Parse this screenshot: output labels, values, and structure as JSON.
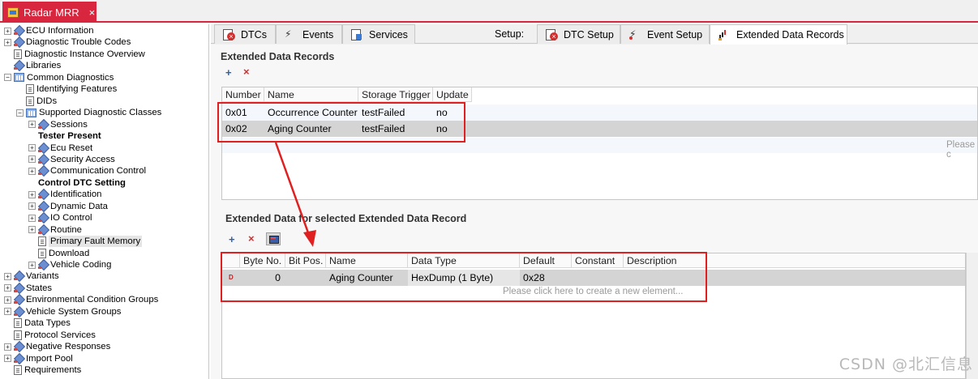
{
  "document_tab": {
    "title": "Radar MRR",
    "close": "×"
  },
  "tree": [
    {
      "label": "ECU Information",
      "indent": 0,
      "exp": "+",
      "icon": "diamond"
    },
    {
      "label": "Diagnostic Trouble Codes",
      "indent": 0,
      "exp": "+",
      "icon": "diamond"
    },
    {
      "label": "Diagnostic Instance Overview",
      "indent": 0,
      "exp": "",
      "icon": "doc"
    },
    {
      "label": "Libraries",
      "indent": 0,
      "exp": "",
      "icon": "diamond"
    },
    {
      "label": "Common Diagnostics",
      "indent": 0,
      "exp": "-",
      "icon": "folder"
    },
    {
      "label": "Identifying Features",
      "indent": 1,
      "exp": "",
      "icon": "doc"
    },
    {
      "label": "DIDs",
      "indent": 1,
      "exp": "",
      "icon": "doc"
    },
    {
      "label": "Supported Diagnostic Classes",
      "indent": 1,
      "exp": "-",
      "icon": "folder"
    },
    {
      "label": "Sessions",
      "indent": 2,
      "exp": "+",
      "icon": "diamond"
    },
    {
      "label": "Tester Present",
      "indent": 2,
      "exp": "",
      "icon": "none",
      "bold": true
    },
    {
      "label": "Ecu Reset",
      "indent": 2,
      "exp": "+",
      "icon": "diamond"
    },
    {
      "label": "Security Access",
      "indent": 2,
      "exp": "+",
      "icon": "diamond"
    },
    {
      "label": "Communication Control",
      "indent": 2,
      "exp": "+",
      "icon": "diamond"
    },
    {
      "label": "Control DTC Setting",
      "indent": 2,
      "exp": "",
      "icon": "none",
      "bold": true
    },
    {
      "label": "Identification",
      "indent": 2,
      "exp": "+",
      "icon": "diamond"
    },
    {
      "label": "Dynamic Data",
      "indent": 2,
      "exp": "+",
      "icon": "diamond"
    },
    {
      "label": "IO Control",
      "indent": 2,
      "exp": "+",
      "icon": "diamond"
    },
    {
      "label": "Routine",
      "indent": 2,
      "exp": "+",
      "icon": "diamond"
    },
    {
      "label": "Primary Fault Memory",
      "indent": 2,
      "exp": "",
      "icon": "doc",
      "selected": true
    },
    {
      "label": "Download",
      "indent": 2,
      "exp": "",
      "icon": "doc"
    },
    {
      "label": "Vehicle Coding",
      "indent": 2,
      "exp": "+",
      "icon": "diamond"
    },
    {
      "label": "Variants",
      "indent": 0,
      "exp": "+",
      "icon": "diamond"
    },
    {
      "label": "States",
      "indent": 0,
      "exp": "+",
      "icon": "diamond"
    },
    {
      "label": "Environmental Condition Groups",
      "indent": 0,
      "exp": "+",
      "icon": "diamond"
    },
    {
      "label": "Vehicle System Groups",
      "indent": 0,
      "exp": "+",
      "icon": "diamond"
    },
    {
      "label": "Data Types",
      "indent": 0,
      "exp": "",
      "icon": "doc"
    },
    {
      "label": "Protocol Services",
      "indent": 0,
      "exp": "",
      "icon": "doc"
    },
    {
      "label": "Negative Responses",
      "indent": 0,
      "exp": "+",
      "icon": "diamond"
    },
    {
      "label": "Import Pool",
      "indent": 0,
      "exp": "+",
      "icon": "diamond"
    },
    {
      "label": "Requirements",
      "indent": 0,
      "exp": "",
      "icon": "doc"
    }
  ],
  "view_tabs": {
    "dtcs": "DTCs",
    "events": "Events",
    "services": "Services",
    "setup_label": "Setup:",
    "dtc_setup": "DTC Setup",
    "event_setup": "Event Setup",
    "extended_data_records": "Extended Data Records"
  },
  "records_section": {
    "title": "Extended Data Records",
    "add": "+",
    "remove": "×",
    "columns": [
      "Number",
      "Name",
      "Storage Trigger",
      "Update"
    ],
    "rows": [
      {
        "number": "0x01",
        "name": "Occurrence Counter",
        "trigger": "testFailed",
        "update": "no"
      },
      {
        "number": "0x02",
        "name": "Aging Counter",
        "trigger": "testFailed",
        "update": "no"
      }
    ],
    "placeholder": "Please c"
  },
  "data_section": {
    "title": "Extended Data for selected Extended Data Record",
    "add": "+",
    "remove": "×",
    "columns": [
      "Byte No.",
      "Bit Pos.",
      "Name",
      "Data Type",
      "Default",
      "Constant",
      "Description"
    ],
    "rows": [
      {
        "marker": "D",
        "byte_no": "0",
        "bit_pos": "",
        "name": "Aging Counter",
        "data_type": "HexDump (1 Byte)",
        "default": "0x28",
        "constant": "",
        "description": ""
      }
    ],
    "placeholder": "Please click here to create a new element..."
  },
  "watermark": "CSDN @北汇信息",
  "colors": {
    "accent_red": "#d7263d",
    "annotation_red": "#e02020",
    "selected_row": "#d4d4d4"
  }
}
